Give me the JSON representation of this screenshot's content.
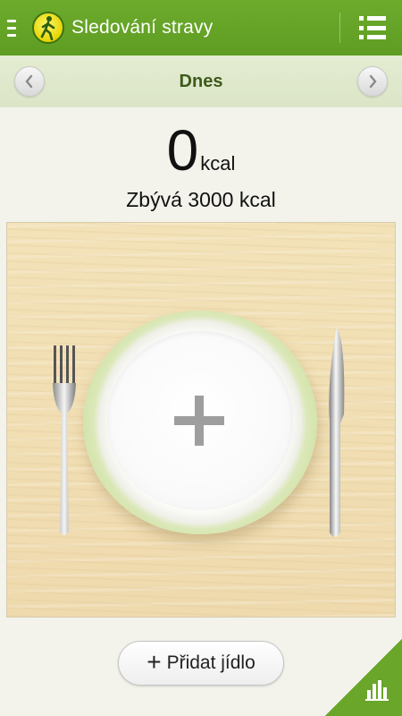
{
  "appbar": {
    "title": "Sledování stravy",
    "drawer_icon": "drawer-indicator-icon",
    "logo_icon": "walking-person-logo",
    "menu_icon": "list-menu-icon"
  },
  "day_nav": {
    "label": "Dnes",
    "prev_icon": "chevron-left-icon",
    "next_icon": "chevron-right-icon"
  },
  "summary": {
    "kcal_value": "0",
    "kcal_unit": "kcal",
    "remaining_text": "Zbývá 3000 kcal"
  },
  "plate": {
    "add_icon": "plus-icon"
  },
  "add_food": {
    "plus": "+",
    "label": "Přidat jídlo"
  },
  "stats": {
    "icon": "bar-chart-icon"
  },
  "colors": {
    "accent_green": "#6aa62a",
    "daybar_bg": "#e0e9cc",
    "day_label": "#3d5a1c"
  }
}
